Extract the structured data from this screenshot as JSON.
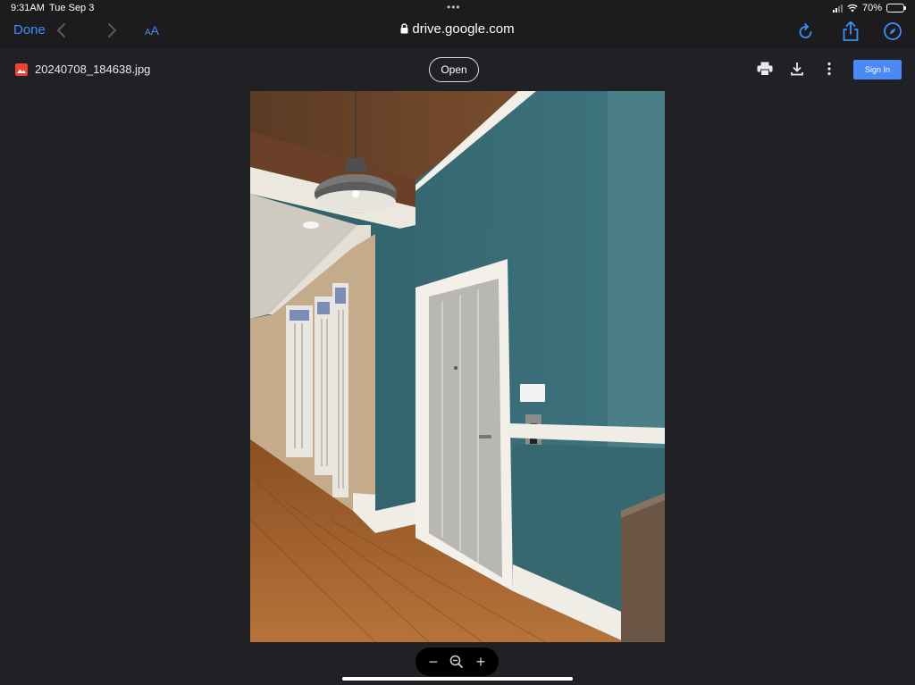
{
  "status": {
    "time": "9:31AM",
    "date": "Tue Sep 3",
    "battery": "70%",
    "battery_level": 0.7
  },
  "browser": {
    "done_label": "Done",
    "reader_label_small": "A",
    "reader_label_large": "A",
    "url": "drive.google.com",
    "icons": [
      "chevron-left-icon",
      "chevron-right-icon",
      "lock-icon",
      "reload-icon",
      "share-icon",
      "compass-icon"
    ]
  },
  "viewer": {
    "file_name": "20240708_184638.jpg",
    "open_label": "Open",
    "sign_in_label": "Sign In",
    "icons": [
      "image-file-icon",
      "print-icon",
      "download-icon",
      "more-vert-icon"
    ]
  },
  "zoom": {
    "minus": "−",
    "plus": "+",
    "icon": "zoom-out-icon"
  },
  "colors": {
    "accent": "#3e8ff5",
    "sign_in": "#4a8af4",
    "background": "#202124",
    "wall": "#3c6f78"
  }
}
